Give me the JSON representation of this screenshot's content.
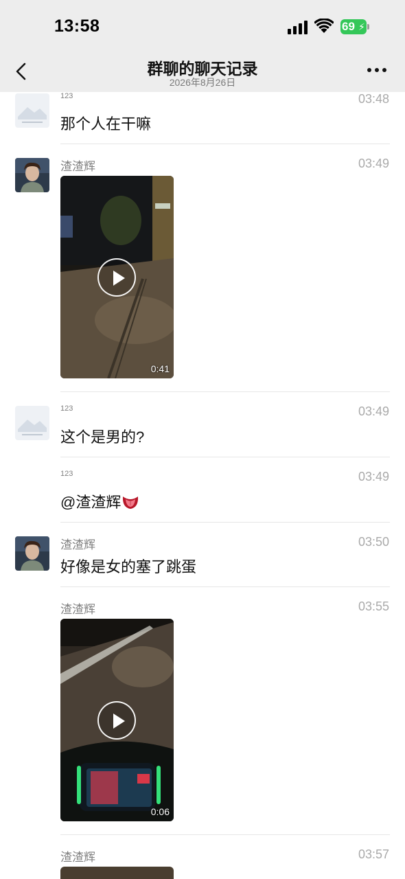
{
  "status_bar": {
    "time": "13:58",
    "battery": "69"
  },
  "header": {
    "title": "群聊的聊天记录",
    "date": "2026年8月26日"
  },
  "messages": [
    {
      "sender": "123",
      "time": "03:48",
      "text": "那个人在干嘛"
    },
    {
      "sender": "渣渣辉",
      "time": "03:49",
      "video_duration": "0:41"
    },
    {
      "sender": "123",
      "time": "03:49",
      "text": "这个是男的?"
    },
    {
      "sender": "123",
      "time": "03:49",
      "text": "@渣渣辉"
    },
    {
      "sender": "渣渣辉",
      "time": "03:50",
      "text": "好像是女的塞了跳蛋"
    },
    {
      "sender": "渣渣辉",
      "time": "03:55",
      "video_duration": "0:06"
    },
    {
      "sender": "渣渣辉",
      "time": "03:57"
    }
  ],
  "colors": {
    "header_bg": "#ededed",
    "battery": "#34c759"
  },
  "icons": [
    "back-chevron-icon",
    "more-dots-icon",
    "signal-icon",
    "wifi-icon",
    "play-icon",
    "tongue-emoji"
  ]
}
